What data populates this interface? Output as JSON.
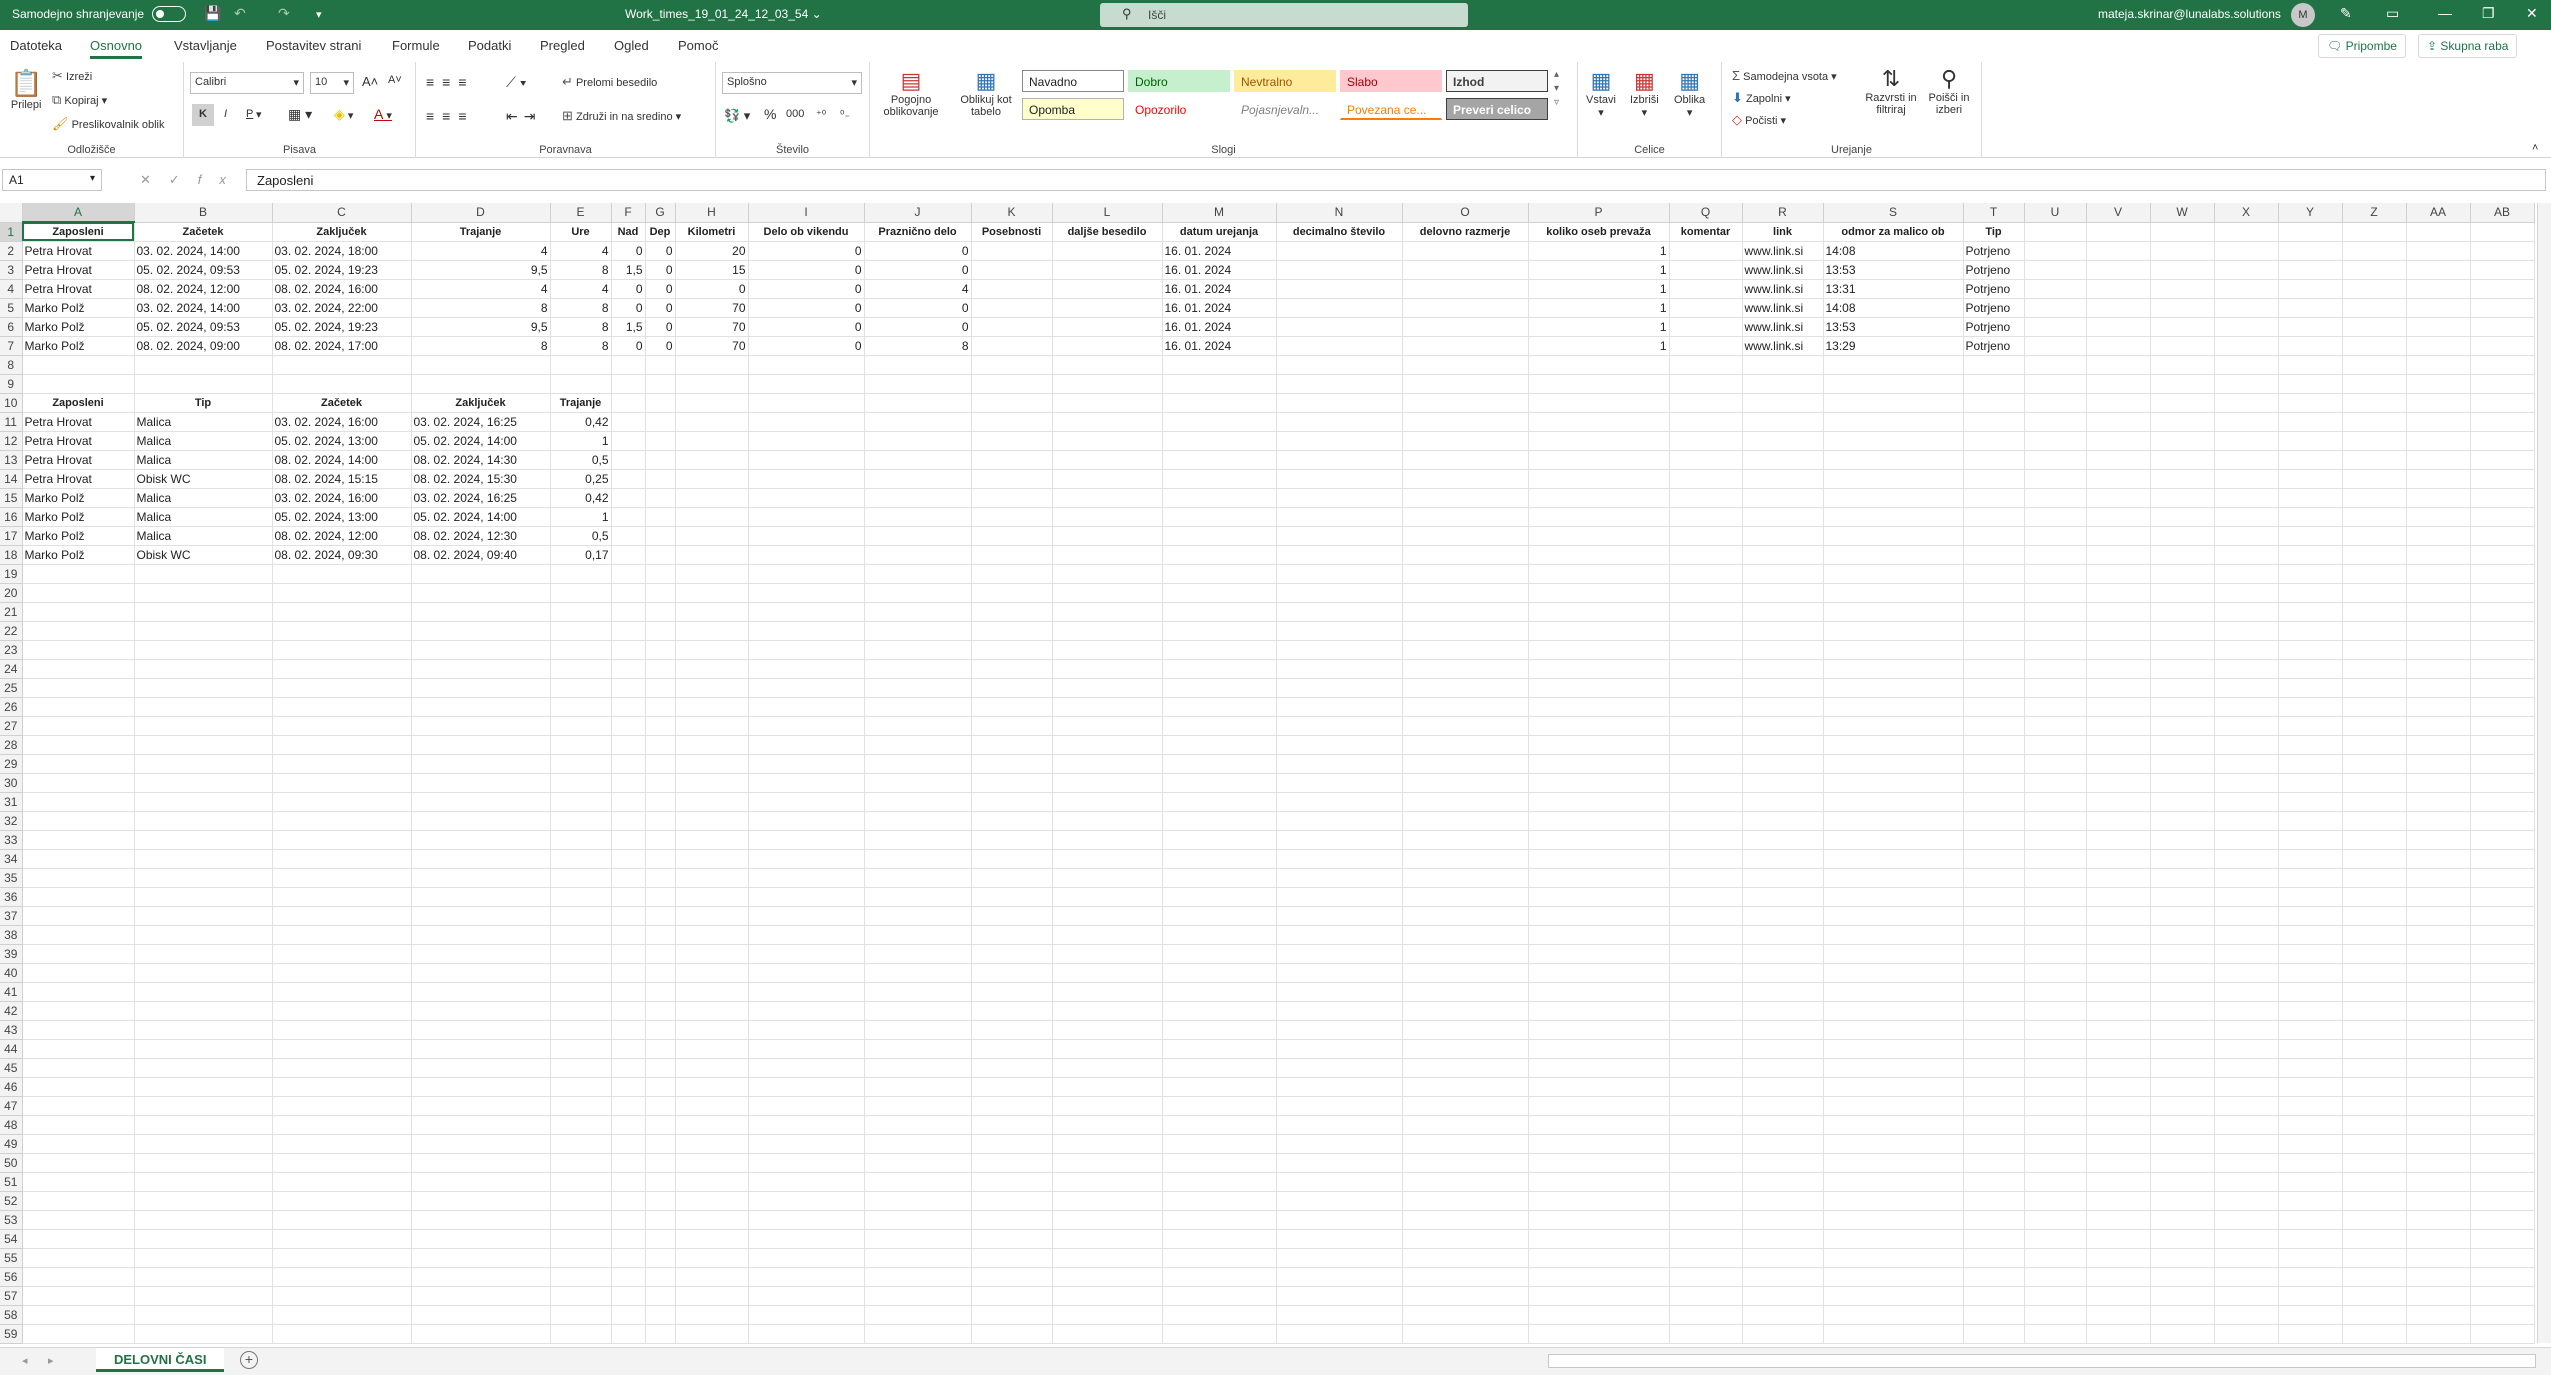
{
  "titlebar": {
    "autosave_label": "Samodejno shranjevanje",
    "doc_title": "Work_times_19_01_24_12_03_54",
    "search_placeholder": "Išči",
    "user": "mateja.skrinar@lunalabs.solutions",
    "avatar_initial": "M"
  },
  "tabs": [
    "Datoteka",
    "Osnovno",
    "Vstavljanje",
    "Postavitev strani",
    "Formule",
    "Podatki",
    "Pregled",
    "Ogled",
    "Pomoč"
  ],
  "active_tab": "Osnovno",
  "top_buttons": {
    "comments": "Pripombe",
    "share": "Skupna raba"
  },
  "ribbon": {
    "clipboard": {
      "paste": "Prilepi",
      "cut": "Izreži",
      "copy": "Kopiraj",
      "format_painter": "Preslikovalnik oblik",
      "label": "Odložišče"
    },
    "font": {
      "name": "Calibri",
      "size": "10",
      "bold": "K",
      "italic": "I",
      "underline": "P",
      "label": "Pisava"
    },
    "alignment": {
      "wrap": "Prelomi besedilo",
      "merge": "Združi in na sredino",
      "label": "Poravnava"
    },
    "number": {
      "format": "Splošno",
      "label": "Število"
    },
    "styles": {
      "conditional": "Pogojno oblikovanje",
      "format_table": "Oblikuj kot tabelo",
      "cells": [
        {
          "name": "Navadno",
          "bg": "#ffffff",
          "fg": "#222222",
          "border": "#888888"
        },
        {
          "name": "Dobro",
          "bg": "#c6efce",
          "fg": "#006100",
          "border": "#c6efce"
        },
        {
          "name": "Nevtralno",
          "bg": "#ffeb9c",
          "fg": "#9c5700",
          "border": "#ffeb9c"
        },
        {
          "name": "Slabo",
          "bg": "#ffc7ce",
          "fg": "#9c0006",
          "border": "#ffc7ce"
        },
        {
          "name": "Izhod",
          "bg": "#f2f2f2",
          "fg": "#3f3f3f",
          "border": "#3f3f3f"
        },
        {
          "name": "Opomba",
          "bg": "#ffffcc",
          "fg": "#222222",
          "border": "#b2b2b2"
        },
        {
          "name": "Opozorilo",
          "bg": "#ffffff",
          "fg": "#ff0000",
          "border": "#ffffff"
        },
        {
          "name": "Pojasnjevaln...",
          "bg": "#ffffff",
          "fg": "#7f7f7f",
          "border": "#ffffff"
        },
        {
          "name": "Povezana ce...",
          "bg": "#ffffff",
          "fg": "#fa7d00",
          "border": "#ffffff"
        },
        {
          "name": "Preveri celico",
          "bg": "#a5a5a5",
          "fg": "#ffffff",
          "border": "#3f3f3f"
        }
      ],
      "label": "Slogi"
    },
    "cells": {
      "insert": "Vstavi",
      "delete": "Izbriši",
      "format": "Oblika",
      "label": "Celice"
    },
    "editing": {
      "autosum": "Samodejna vsota",
      "fill": "Zapolni",
      "clear": "Počisti",
      "sort": "Razvrsti in filtriraj",
      "find": "Poišči in izberi",
      "label": "Urejanje"
    }
  },
  "formula_bar": {
    "name_box": "A1",
    "content": "Zaposleni"
  },
  "columns": [
    "A",
    "B",
    "C",
    "D",
    "E",
    "F",
    "G",
    "H",
    "I",
    "J",
    "K",
    "L",
    "M",
    "N",
    "O",
    "P",
    "Q",
    "R",
    "S",
    "T",
    "U",
    "V",
    "W",
    "X",
    "Y",
    "Z",
    "AA",
    "AB"
  ],
  "table1": {
    "headers": [
      "Zaposleni",
      "Začetek",
      "Zaključek",
      "Trajanje",
      "Ure",
      "Nad",
      "Dep",
      "Kilometri",
      "Delo ob vikendu",
      "Praznično delo",
      "Posebnosti",
      "dalјše besedilo",
      "datum urejanja",
      "decimalno število",
      "delovno razmerje",
      "koliko oseb prevaža",
      "komentar",
      "link",
      "odmor za malico ob",
      "Tip"
    ],
    "rows": [
      [
        "Petra Hrovat",
        "03. 02. 2024, 14:00",
        "03. 02. 2024, 18:00",
        "4",
        "4",
        "0",
        "0",
        "20",
        "0",
        "0",
        "",
        "",
        "16. 01. 2024",
        "",
        "",
        "1",
        "",
        "www.link.si",
        "14:08",
        "Potrjeno"
      ],
      [
        "Petra Hrovat",
        "05. 02. 2024, 09:53",
        "05. 02. 2024, 19:23",
        "9,5",
        "8",
        "1,5",
        "0",
        "15",
        "0",
        "0",
        "",
        "",
        "16. 01. 2024",
        "",
        "",
        "1",
        "",
        "www.link.si",
        "13:53",
        "Potrjeno"
      ],
      [
        "Petra Hrovat",
        "08. 02. 2024, 12:00",
        "08. 02. 2024, 16:00",
        "4",
        "4",
        "0",
        "0",
        "0",
        "0",
        "4",
        "",
        "",
        "16. 01. 2024",
        "",
        "",
        "1",
        "",
        "www.link.si",
        "13:31",
        "Potrjeno"
      ],
      [
        "Marko Polž",
        "03. 02. 2024, 14:00",
        "03. 02. 2024, 22:00",
        "8",
        "8",
        "0",
        "0",
        "70",
        "0",
        "0",
        "",
        "",
        "16. 01. 2024",
        "",
        "",
        "1",
        "",
        "www.link.si",
        "14:08",
        "Potrjeno"
      ],
      [
        "Marko Polž",
        "05. 02. 2024, 09:53",
        "05. 02. 2024, 19:23",
        "9,5",
        "8",
        "1,5",
        "0",
        "70",
        "0",
        "0",
        "",
        "",
        "16. 01. 2024",
        "",
        "",
        "1",
        "",
        "www.link.si",
        "13:53",
        "Potrjeno"
      ],
      [
        "Marko Polž",
        "08. 02. 2024, 09:00",
        "08. 02. 2024, 17:00",
        "8",
        "8",
        "0",
        "0",
        "70",
        "0",
        "8",
        "",
        "",
        "16. 01. 2024",
        "",
        "",
        "1",
        "",
        "www.link.si",
        "13:29",
        "Potrjeno"
      ]
    ]
  },
  "table2": {
    "headers": [
      "Zaposleni",
      "Tip",
      "Začetek",
      "Zaključek",
      "Trajanje"
    ],
    "rows": [
      [
        "Petra Hrovat",
        "Malica",
        "03. 02. 2024, 16:00",
        "03. 02. 2024, 16:25",
        "0,42"
      ],
      [
        "Petra Hrovat",
        "Malica",
        "05. 02. 2024, 13:00",
        "05. 02. 2024, 14:00",
        "1"
      ],
      [
        "Petra Hrovat",
        "Malica",
        "08. 02. 2024, 14:00",
        "08. 02. 2024, 14:30",
        "0,5"
      ],
      [
        "Petra Hrovat",
        "Obisk WC",
        "08. 02. 2024, 15:15",
        "08. 02. 2024, 15:30",
        "0,25"
      ],
      [
        "Marko Polž",
        "Malica",
        "03. 02. 2024, 16:00",
        "03. 02. 2024, 16:25",
        "0,42"
      ],
      [
        "Marko Polž",
        "Malica",
        "05. 02. 2024, 13:00",
        "05. 02. 2024, 14:00",
        "1"
      ],
      [
        "Marko Polž",
        "Malica",
        "08. 02. 2024, 12:00",
        "08. 02. 2024, 12:30",
        "0,5"
      ],
      [
        "Marko Polž",
        "Obisk WC",
        "08. 02. 2024, 09:30",
        "08. 02. 2024, 09:40",
        "0,17"
      ]
    ]
  },
  "row_count": 59,
  "sheet_tab": "DELOVNI ČASI"
}
